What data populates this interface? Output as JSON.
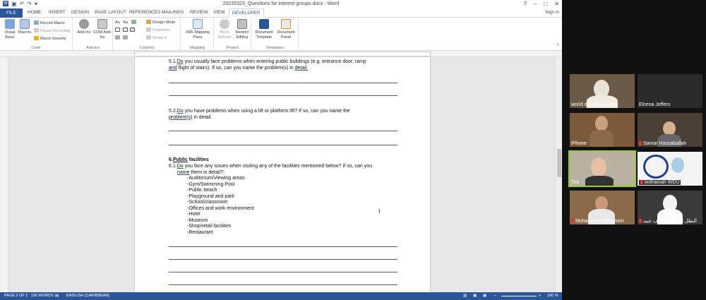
{
  "word": {
    "title": "20220323_Questions for interest groups.docx - Word",
    "window_controls": [
      "?",
      "–",
      "□",
      "✕"
    ],
    "tabs": {
      "file": "FILE",
      "home": "HOME",
      "insert": "INSERT",
      "design": "DESIGN",
      "page_layout": "PAGE LAYOUT",
      "references": "REFERENCES",
      "mailings": "MAILINGS",
      "review": "REVIEW",
      "view": "VIEW",
      "developer": "DEVELOPER"
    },
    "sign_in": "Sign in",
    "ribbon": {
      "code": {
        "label": "Code",
        "visual_basic": "Visual Basic",
        "macros": "Macros",
        "record_macro": "Record Macro",
        "pause_recording": "Pause Recording",
        "macro_security": "Macro Security"
      },
      "addins": {
        "label": "Add-Ins",
        "add_ins": "Add-Ins",
        "com_add_ins": "COM Add-Ins"
      },
      "controls": {
        "label": "Controls",
        "design_mode": "Design Mode",
        "properties": "Properties",
        "group": "Group"
      },
      "mapping": {
        "label": "Mapping",
        "xml_mapping_pane": "XML Mapping Pane"
      },
      "protect": {
        "label": "Protect",
        "block_authors": "Block Authors",
        "restrict_editing": "Restrict Editing"
      },
      "templates": {
        "label": "Templates",
        "document_template": "Document Template",
        "document_panel": "Document Panel"
      }
    },
    "document": {
      "q51_num": "5.1.",
      "q51_do": "Do",
      "q51_a": " you usually face problems when entering public buildings (e.g. entrance door, ramp",
      "q51_and": "and",
      "q51_b": " flight of stairs). If so, can you name the problem(s) in ",
      "q51_detail": "detail.",
      "q52_num": "5.2.",
      "q52_do": "Do",
      "q52_a": " you have problems when using a lift or platform lift? If so, can you name the",
      "q52_problem": "problem(s)",
      "q52_b": " in detail.",
      "h6_num": "6.",
      "h6_public": "Public",
      "h6_rest": " facilities",
      "q61_num": "6.1.",
      "q61_do": "Do",
      "q61_a": " you face any issues when visiting any of the facilities mentioned below? If so, can you",
      "q61_name": "name",
      "q61_b": " them in detail?:",
      "facilities": [
        "-Auditorium/Viewing areas",
        "-Gym/Swimming Pool",
        "-Public beach",
        "-Playground and park",
        "-School/classroom",
        "-Offices and work environment",
        "-Hotel",
        "-Museum",
        "-Shop/retail facilities",
        "-Restaurant"
      ]
    },
    "status": {
      "page": "PAGE 2 OF 2",
      "words": "190 WORDS",
      "language": "ENGLISH (CARIBBEAN)",
      "zoom": "100 %"
    }
  },
  "participants": [
    {
      "name": "world disability union"
    },
    {
      "name": "Elcena Jeffers"
    },
    {
      "name": "iPhone"
    },
    {
      "name": "Samar Hassaballah"
    },
    {
      "name": "Tim"
    },
    {
      "name": "bothainah WDU"
    },
    {
      "name": "Muhammad Alhussein"
    },
    {
      "name": "البطل الأولمبي نصيف عبيد"
    }
  ],
  "colors": {
    "word_blue": "#2b579a",
    "active_speaker": "#9acd32",
    "muted_red": "#e33333"
  }
}
